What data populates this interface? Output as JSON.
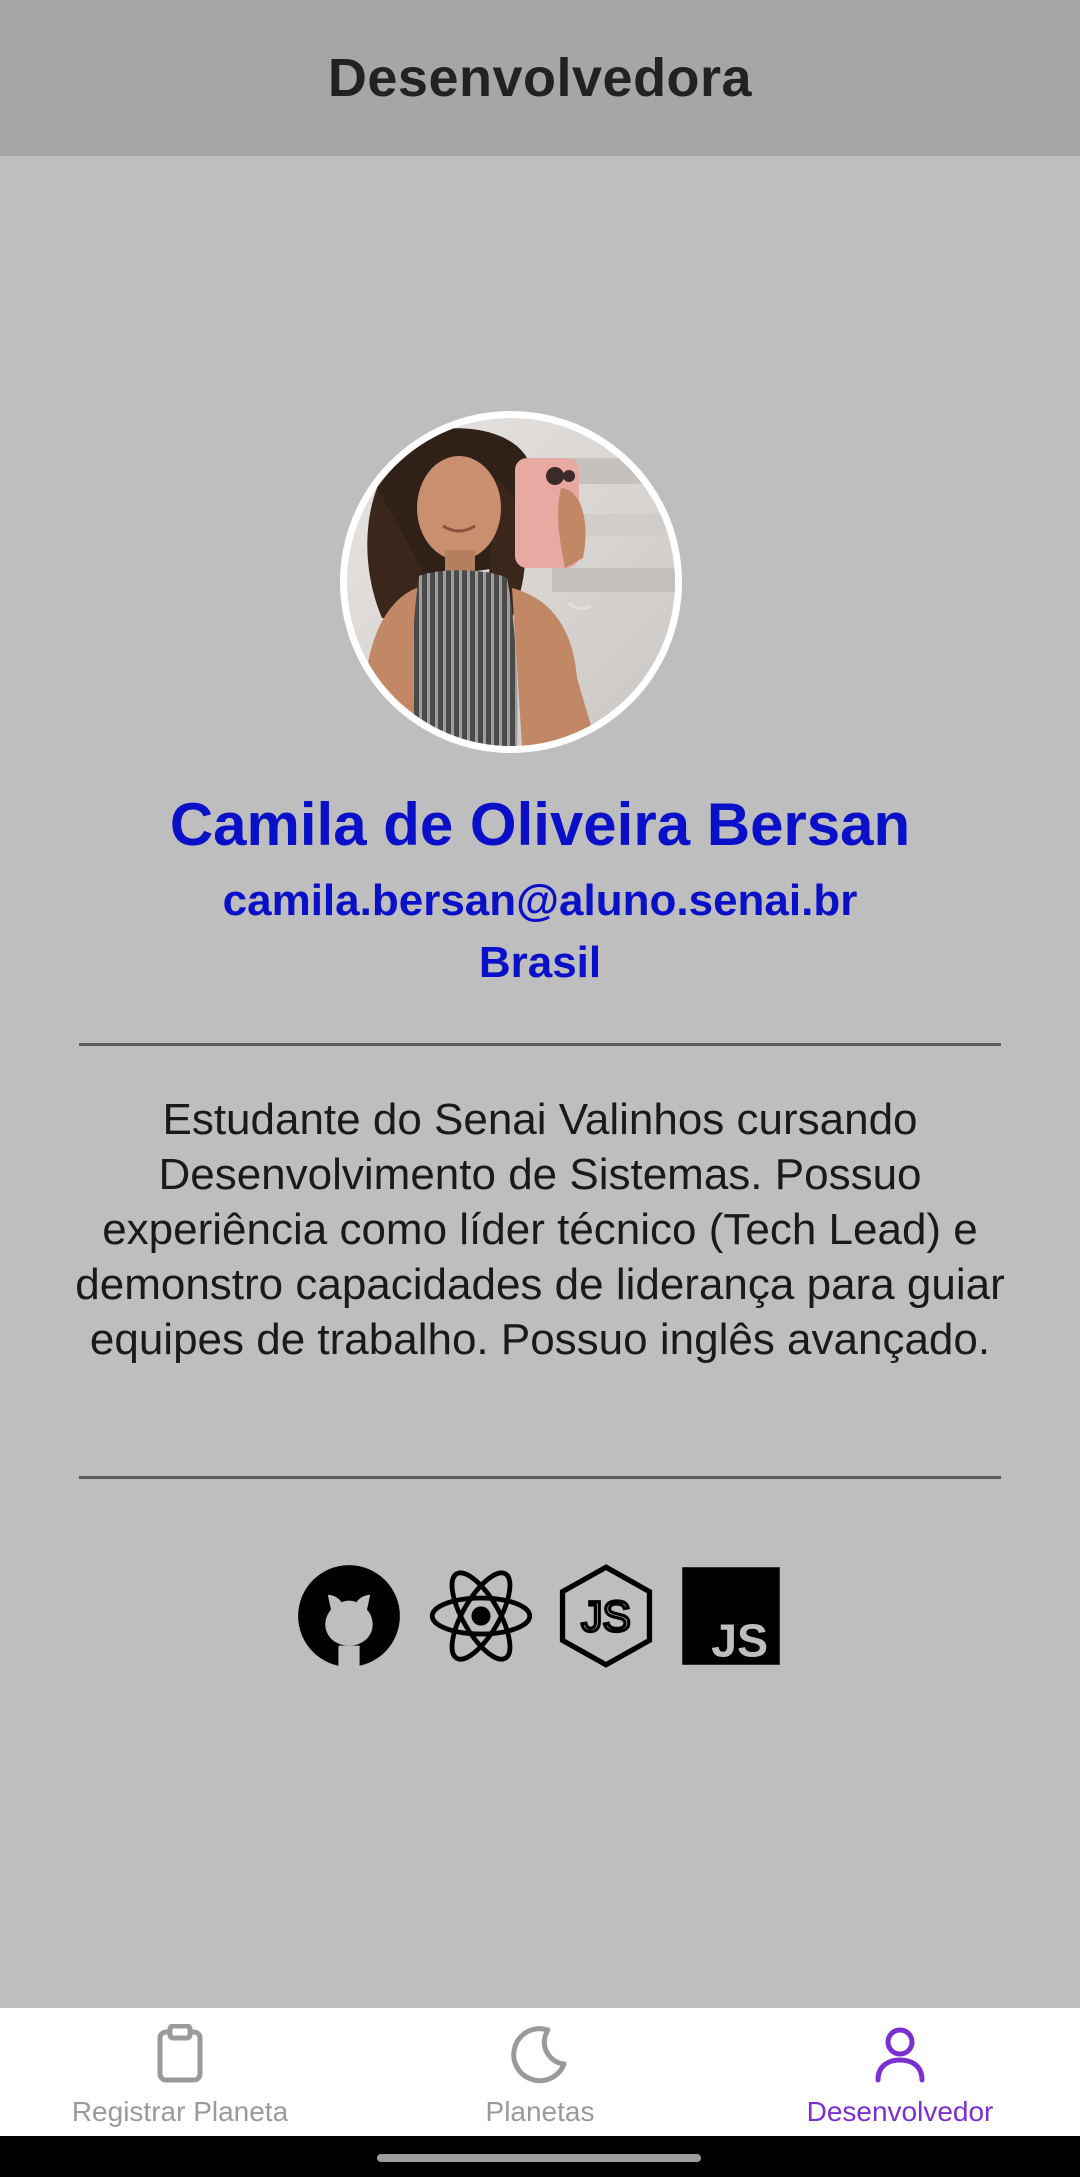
{
  "header": {
    "title": "Desenvolvedora"
  },
  "profile": {
    "avatar_icon": "profile-photo",
    "name": "Camila de Oliveira Bersan",
    "email": "camila.bersan@aluno.senai.br",
    "country": "Brasil",
    "bio": "Estudante do Senai Valinhos cursando Desenvolvimento de Sistemas. Possuo experiência como líder técnico (Tech Lead) e demonstro capacidades de liderança para guiar equipes de trabalho. Possuo inglês avançado.",
    "name_color": "#0a0fc8"
  },
  "tech_icons": [
    {
      "icon": "github-icon"
    },
    {
      "icon": "react-icon"
    },
    {
      "icon": "nodejs-icon"
    },
    {
      "icon": "javascript-icon",
      "text": "JS"
    }
  ],
  "bottom_nav": {
    "items": [
      {
        "label": "Registrar Planeta",
        "icon": "clipboard-icon",
        "active": false
      },
      {
        "label": "Planetas",
        "icon": "moon-icon",
        "active": false
      },
      {
        "label": "Desenvolvedor",
        "icon": "person-icon",
        "active": true
      }
    ],
    "active_color": "#7b2fd1",
    "inactive_color": "#9a9a9a"
  }
}
